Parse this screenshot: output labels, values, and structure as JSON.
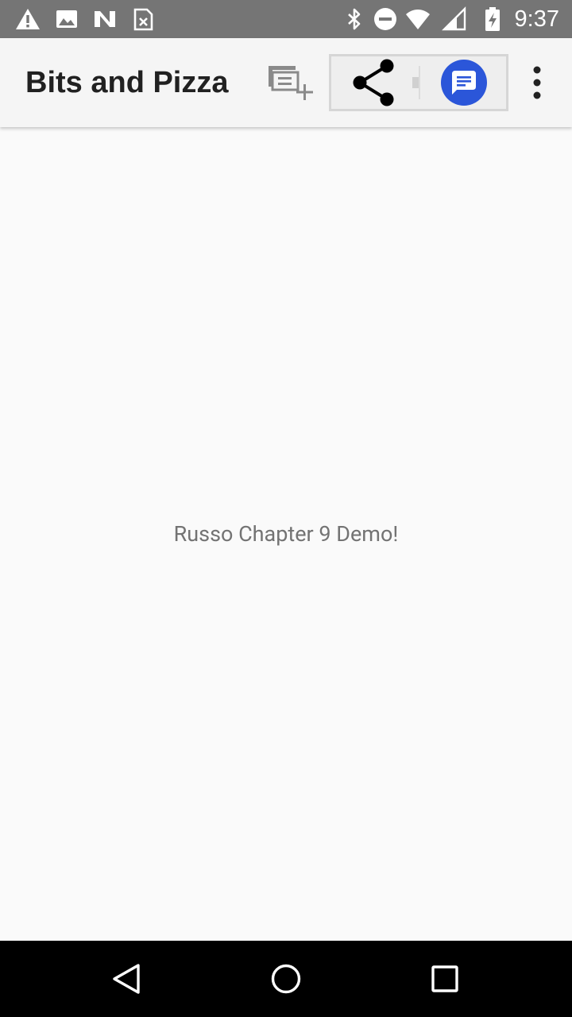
{
  "status_bar": {
    "time": "9:37",
    "left_icons": [
      "warning-icon",
      "image-icon",
      "n-notification-icon",
      "sim-card-icon"
    ],
    "right_icons": [
      "bluetooth-icon",
      "do-not-disturb-icon",
      "wifi-icon",
      "cellular-signal-icon",
      "battery-charging-icon"
    ]
  },
  "app_bar": {
    "title": "Bits and Pizza",
    "actions": [
      "create-order-icon",
      "share-icon",
      "messages-icon",
      "overflow-menu-icon"
    ]
  },
  "content": {
    "message": "Russo Chapter 9 Demo!"
  },
  "nav_bar": {
    "buttons": [
      "back-icon",
      "home-icon",
      "recents-icon"
    ]
  },
  "colors": {
    "status_bar_bg": "#757575",
    "app_bar_bg": "#f5f5f5",
    "content_bg": "#fafafa",
    "messages_accent": "#2b56d9",
    "nav_bar_bg": "#000000"
  }
}
